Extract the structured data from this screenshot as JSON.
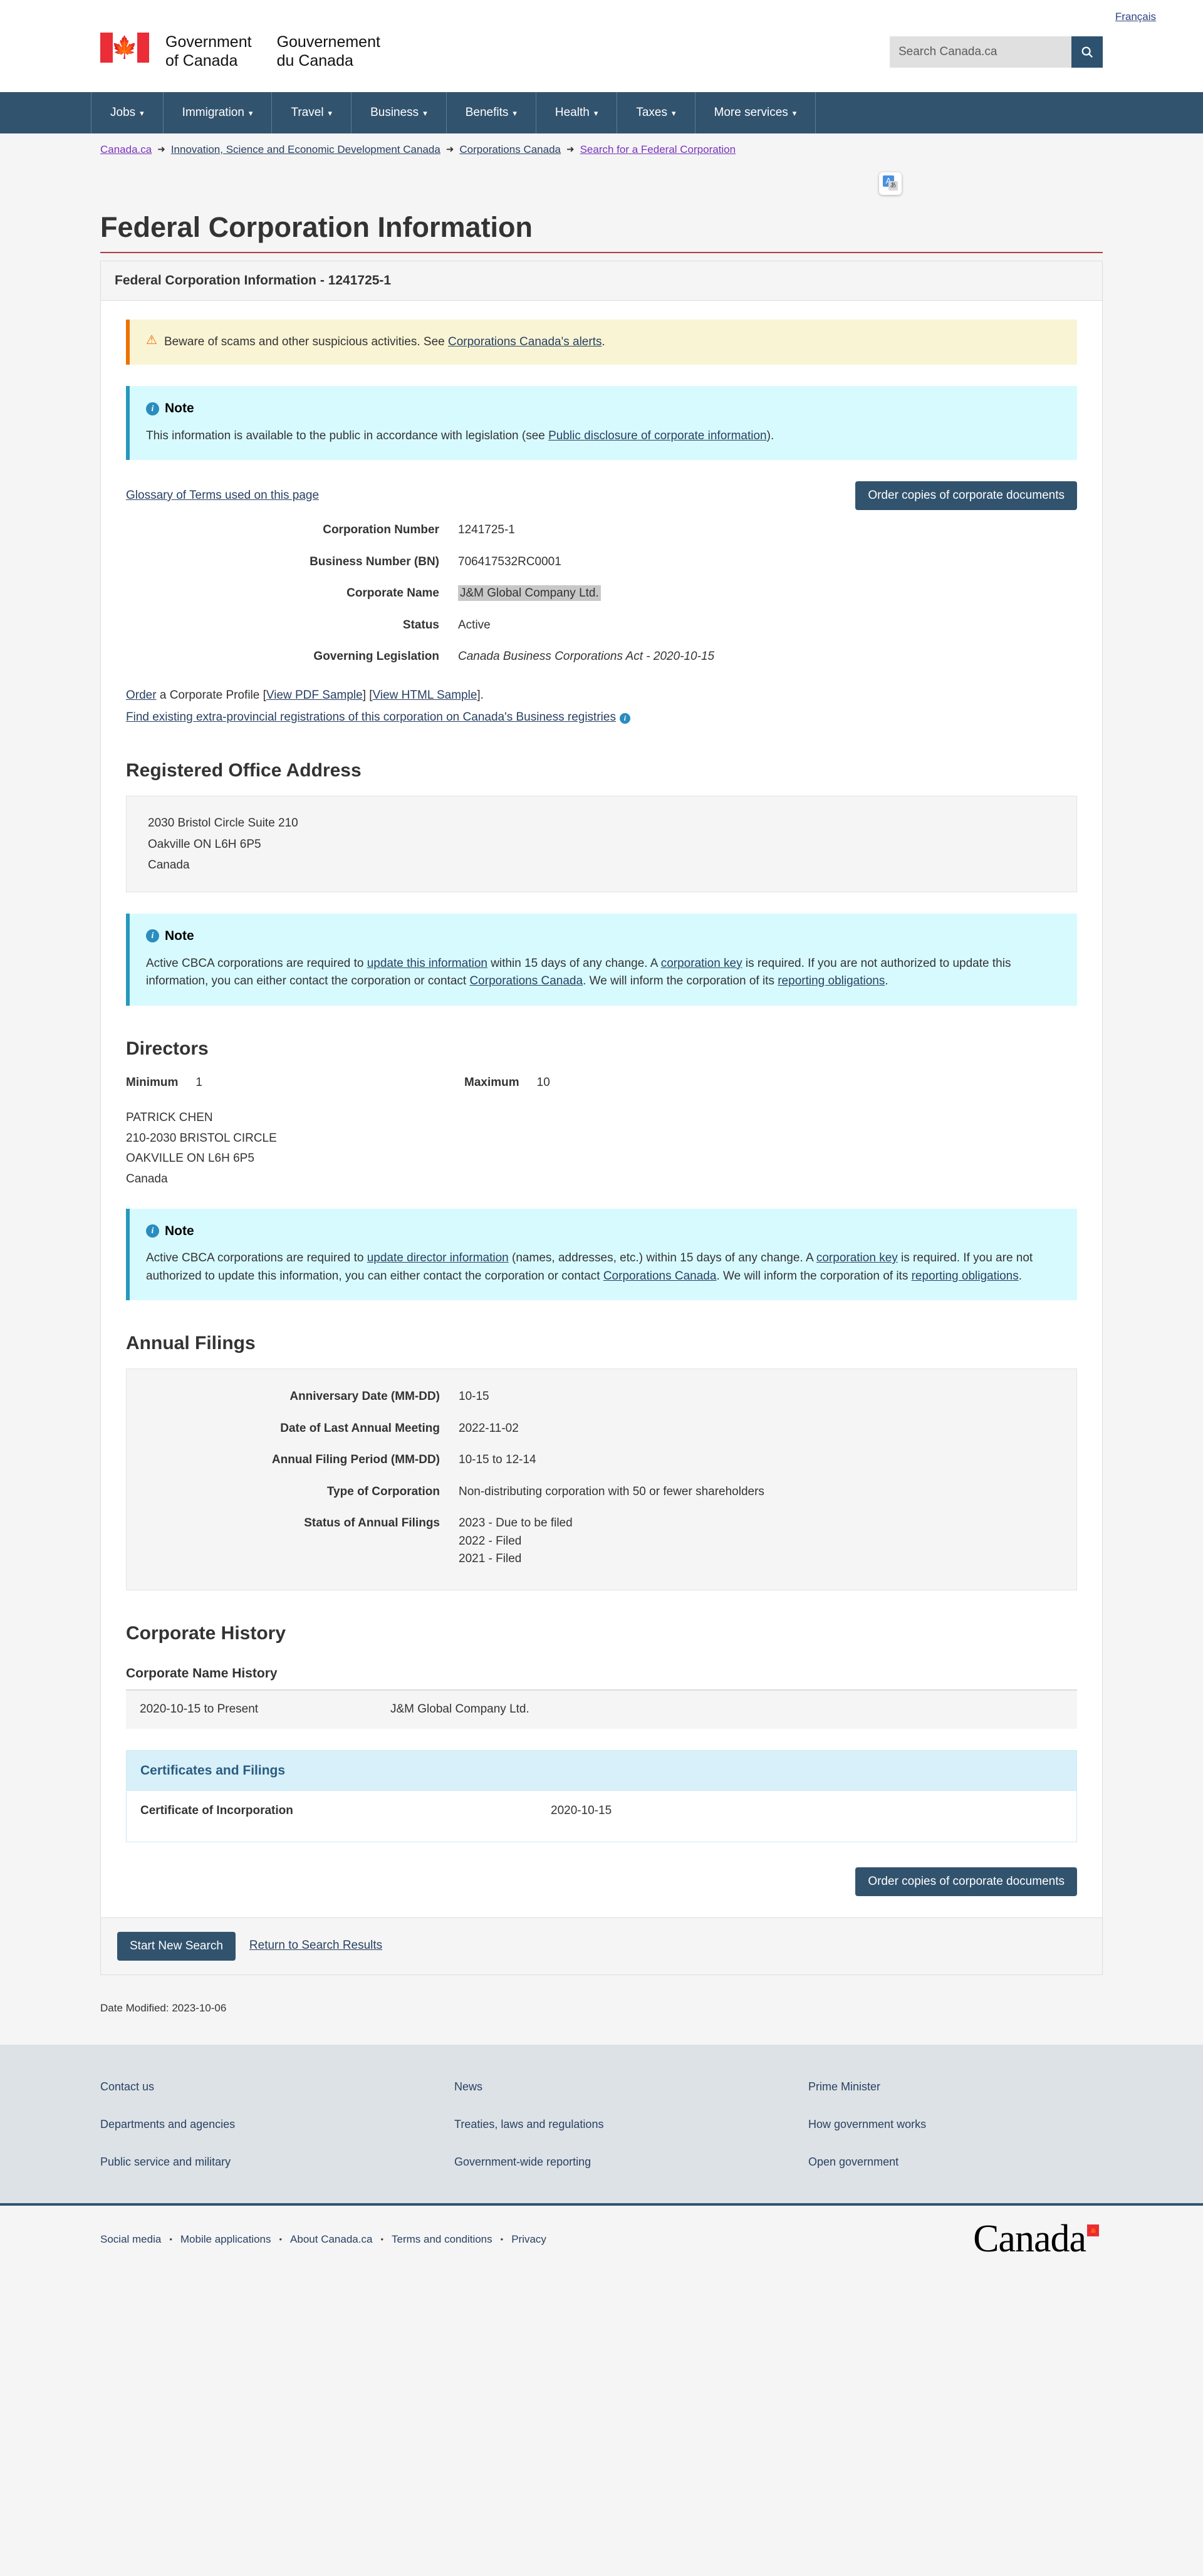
{
  "header": {
    "language_link": "Français",
    "signature_en_line1": "Government",
    "signature_en_line2": "of Canada",
    "signature_fr_line1": "Gouvernement",
    "signature_fr_line2": "du Canada",
    "search_placeholder": "Search Canada.ca",
    "search_value": "",
    "search_icon": "search-icon"
  },
  "menu": {
    "items": [
      {
        "label": "Jobs"
      },
      {
        "label": "Immigration"
      },
      {
        "label": "Travel"
      },
      {
        "label": "Business"
      },
      {
        "label": "Benefits"
      },
      {
        "label": "Health"
      },
      {
        "label": "Taxes"
      },
      {
        "label": "More services"
      }
    ],
    "caret": "▾"
  },
  "breadcrumb": {
    "items": [
      {
        "label": "Canada.ca",
        "visited": true
      },
      {
        "label": "Innovation, Science and Economic Development Canada",
        "visited": false
      },
      {
        "label": "Corporations Canada",
        "visited": false
      },
      {
        "label": "Search for a Federal Corporation",
        "visited": true
      }
    ],
    "separator": "➜"
  },
  "translate_extension": {
    "name": "google-translate-extension-icon",
    "letter": "A",
    "glyph": "あ"
  },
  "page": {
    "title": "Federal Corporation Information",
    "panel_heading": "Federal Corporation Information - 1241725-1"
  },
  "alerts": {
    "scam": {
      "icon": "warning-triangle-icon",
      "text_before": "Beware of scams and other suspicious activities. See ",
      "link": "Corporations Canada's alerts",
      "text_after": "."
    },
    "disclosure": {
      "icon": "info-circle-icon",
      "title": "Note",
      "text_before": "This information is available to the public in accordance with legislation (see ",
      "link": "Public disclosure of corporate information",
      "text_after": ")."
    }
  },
  "glossary": {
    "link": "Glossary of Terms used on this page",
    "order_button": "Order copies of corporate documents"
  },
  "corporation": {
    "rows": [
      {
        "term": "Corporation Number",
        "value": "1241725-1"
      },
      {
        "term": "Business Number (BN)",
        "value": "706417532RC0001"
      },
      {
        "term": "Corporate Name",
        "value": "J&M Global Company Ltd."
      },
      {
        "term": "Status",
        "value": "Active"
      },
      {
        "term": "Governing Legislation",
        "value": "Canada Business Corporations Act - 2020-10-15"
      }
    ],
    "links": {
      "order": "Order",
      "profile_text": " a Corporate Profile [",
      "pdf_sample": "View PDF Sample",
      "between": "] [",
      "html_sample": "View HTML Sample",
      "end": "].",
      "extra_provincial": "Find existing extra-provincial registrations of this corporation on Canada's Business registries",
      "extra_provincial_icon": "info-circle-icon"
    }
  },
  "registered_office": {
    "heading": "Registered Office Address",
    "address_lines": [
      "2030 Bristol Circle Suite 210",
      "Oakville ON L6H 6P5",
      "Canada"
    ],
    "note": {
      "icon": "info-circle-icon",
      "title": "Note",
      "p1": "Active CBCA corporations are required to ",
      "link1": "update this information",
      "p2": " within 15 days of any change. A ",
      "link2": "corporation key",
      "p3": " is required. If you are not authorized to update this information, you can either contact the corporation or contact ",
      "link3": "Corporations Canada",
      "p4": ". We will inform the corporation of its ",
      "link4": "reporting obligations",
      "p5": "."
    }
  },
  "directors": {
    "heading": "Directors",
    "minimum_label": "Minimum",
    "minimum_value": "1",
    "maximum_label": "Maximum",
    "maximum_value": "10",
    "list": [
      {
        "name": "PATRICK CHEN",
        "lines": [
          "210-2030 BRISTOL CIRCLE",
          "OAKVILLE ON L6H 6P5",
          "Canada"
        ]
      }
    ],
    "note": {
      "icon": "info-circle-icon",
      "title": "Note",
      "p1": "Active CBCA corporations are required to ",
      "link1": "update director information",
      "p2": " (names, addresses, etc.) within 15 days of any change. A ",
      "link2": "corporation key",
      "p3": " is required. If you are not authorized to update this information, you can either contact the corporation or contact ",
      "link3": "Corporations Canada",
      "p4": ". We will inform the corporation of its ",
      "link4": "reporting obligations",
      "p5": "."
    }
  },
  "annual_filings": {
    "heading": "Annual Filings",
    "rows": [
      {
        "term": "Anniversary Date (MM-DD)",
        "value": "10-15"
      },
      {
        "term": "Date of Last Annual Meeting",
        "value": "2022-11-02"
      },
      {
        "term": "Annual Filing Period (MM-DD)",
        "value": "10-15 to 12-14"
      },
      {
        "term": "Type of Corporation",
        "value": "Non-distributing corporation with 50 or fewer shareholders"
      }
    ],
    "status_label": "Status of Annual Filings",
    "status_values": [
      "2023 - Due to be filed",
      "2022 - Filed",
      "2021 - Filed"
    ]
  },
  "corporate_history": {
    "heading": "Corporate History",
    "name_history_heading": "Corporate Name History",
    "name_history_rows": [
      {
        "period": "2020-10-15 to Present",
        "name": "J&M Global Company Ltd."
      }
    ],
    "certificates_heading": "Certificates and Filings",
    "certificate_rows": [
      {
        "label": "Certificate of Incorporation",
        "date": "2020-10-15"
      }
    ],
    "order_button": "Order copies of corporate documents"
  },
  "action_bar": {
    "start_new_search": "Start New Search",
    "return_link": "Return to Search Results"
  },
  "date_modified": "Date Modified: 2023-10-06",
  "footer": {
    "columns": [
      {
        "links": [
          "Contact us",
          "Departments and agencies",
          "Public service and military"
        ]
      },
      {
        "links": [
          "News",
          "Treaties, laws and regulations",
          "Government-wide reporting"
        ]
      },
      {
        "links": [
          "Prime Minister",
          "How government works",
          "Open government"
        ]
      }
    ],
    "bottom_links": [
      "Social media",
      "Mobile applications",
      "About Canada.ca",
      "Terms and conditions",
      "Privacy"
    ],
    "bottom_separator": "•",
    "wordmark": "Canada"
  },
  "colors": {
    "nav_blue": "#32536e",
    "accent_red": "#af3c43",
    "flag_red": "#ea2d37",
    "info_blue": "#d7faff",
    "warn_yellow": "#f9f4d4",
    "link_blue": "#284162"
  }
}
